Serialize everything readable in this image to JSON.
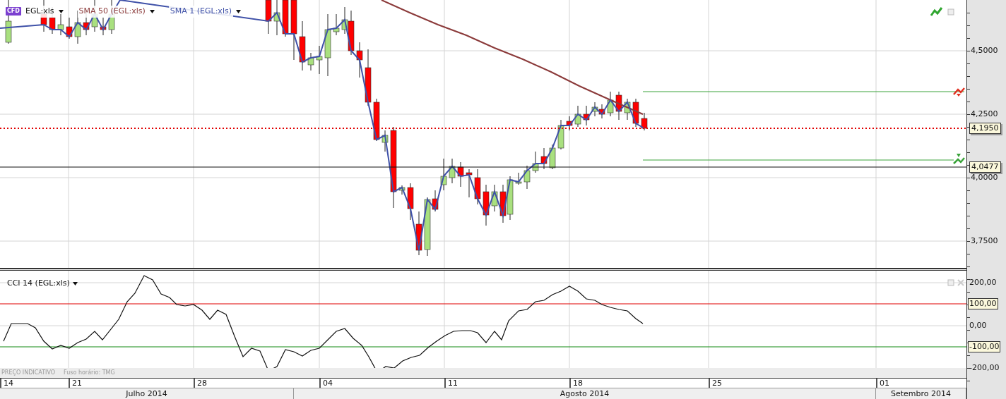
{
  "price_panel": {
    "legend": [
      {
        "kind": "symbol",
        "badge": "CFD",
        "label": "EGL:xls"
      },
      {
        "kind": "indicator",
        "label": "SMA 50 (EGL:xls)",
        "color": "#8b3a3a"
      },
      {
        "kind": "indicator",
        "label": "SMA 1 (EGL:xls)",
        "color": "#3f51a8"
      }
    ],
    "axis_ticks": [
      "4,5000",
      "4,2500",
      "4,0000",
      "3,7500"
    ],
    "markers": [
      {
        "label": "4,1950",
        "kind": "last_price"
      },
      {
        "label": "4,0477",
        "kind": "reference"
      }
    ]
  },
  "cci_panel": {
    "legend": "CCI 14 (EGL:xls)",
    "axis_ticks": [
      "200,00",
      "0,00",
      "-200,00"
    ],
    "markers": [
      {
        "label": "100,00"
      },
      {
        "label": "-100,00"
      }
    ],
    "notes": [
      "PREÇO INDICATIVO",
      "Fuso horário: TMG"
    ]
  },
  "time_axis": {
    "dates": [
      "14",
      "21",
      "28",
      "04",
      "11",
      "18",
      "25",
      "01"
    ],
    "months": [
      "Julho 2014",
      "Agosto 2014",
      "Setembro 2014"
    ]
  }
}
